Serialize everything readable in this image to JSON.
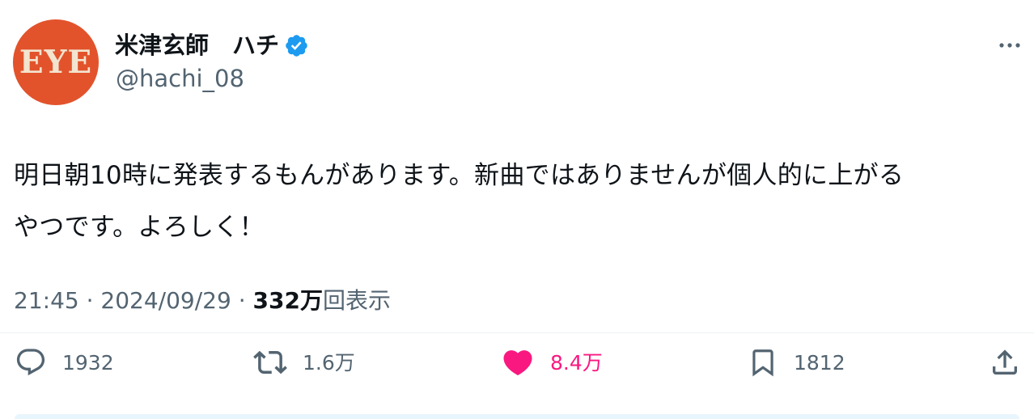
{
  "author": {
    "avatar_text": "EYE",
    "display_name": "米津玄師　ハチ",
    "handle": "@hachi_08",
    "verified": true
  },
  "post": {
    "text_lines": [
      "明日朝10時に発表するもんがあります。新曲ではありませんが個人的に上がる",
      "やつです。よろしく！"
    ]
  },
  "meta": {
    "time": "21:45",
    "separator": "·",
    "date": "2024/09/29",
    "views_count": "332万",
    "views_label": "回表示"
  },
  "actions": {
    "reply_count": "1932",
    "retweet_count": "1.6万",
    "like_count": "8.4万",
    "bookmark_count": "1812"
  },
  "colors": {
    "avatar_bg": "#e2532c",
    "verified_blue": "#1d9bf0",
    "like_pink": "#f91880",
    "muted_text": "#536471"
  },
  "icons": [
    "verified-badge-icon",
    "more-icon",
    "reply-icon",
    "retweet-icon",
    "heart-icon",
    "bookmark-icon",
    "share-icon"
  ]
}
